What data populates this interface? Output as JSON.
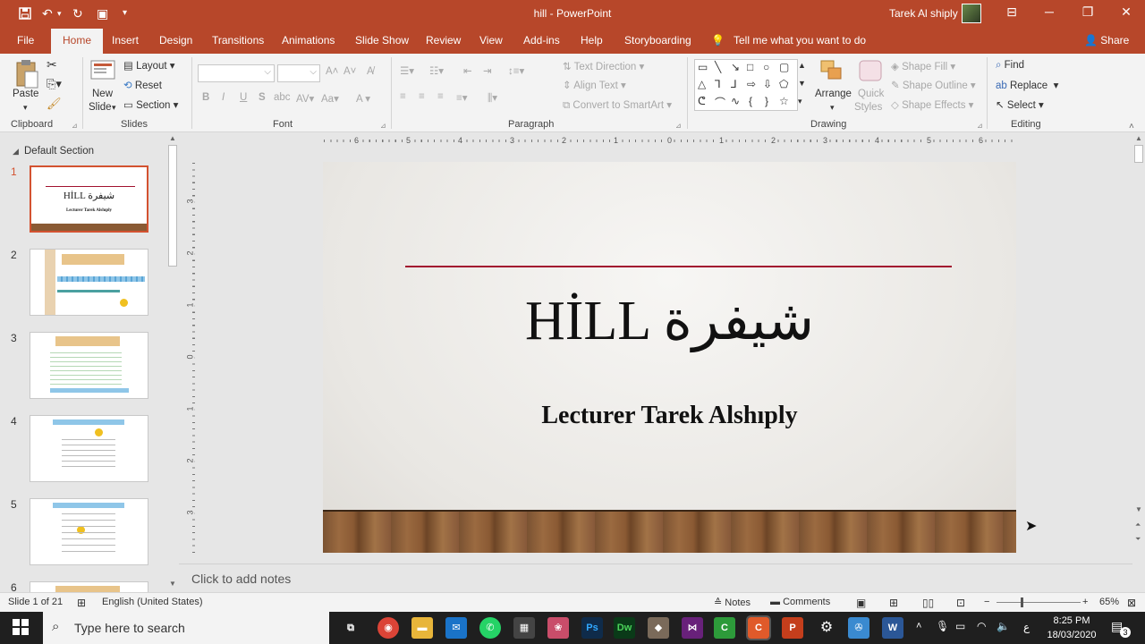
{
  "titlebar": {
    "doc_title": "hill  -  PowerPoint",
    "user": "Tarek Al shiply"
  },
  "tabs": [
    {
      "label": "File",
      "name": "tab-file"
    },
    {
      "label": "Home",
      "name": "tab-home",
      "active": true
    },
    {
      "label": "Insert",
      "name": "tab-insert"
    },
    {
      "label": "Design",
      "name": "tab-design"
    },
    {
      "label": "Transitions",
      "name": "tab-transitions"
    },
    {
      "label": "Animations",
      "name": "tab-animations"
    },
    {
      "label": "Slide Show",
      "name": "tab-slide-show"
    },
    {
      "label": "Review",
      "name": "tab-review"
    },
    {
      "label": "View",
      "name": "tab-view"
    },
    {
      "label": "Add-ins",
      "name": "tab-add-ins"
    },
    {
      "label": "Help",
      "name": "tab-help"
    },
    {
      "label": "Storyboarding",
      "name": "tab-storyboarding"
    }
  ],
  "tell_me": "Tell me what you want to do",
  "share": "Share",
  "ribbon": {
    "clipboard": {
      "label": "Clipboard",
      "paste": "Paste"
    },
    "slides": {
      "label": "Slides",
      "new_slide_1": "New",
      "new_slide_2": "Slide",
      "layout": "Layout",
      "reset": "Reset",
      "section": "Section"
    },
    "font": {
      "label": "Font"
    },
    "paragraph": {
      "label": "Paragraph",
      "text_direction": "Text Direction",
      "align_text": "Align Text",
      "convert_smartart": "Convert to SmartArt"
    },
    "drawing": {
      "label": "Drawing",
      "arrange": "Arrange",
      "quick_styles_1": "Quick",
      "quick_styles_2": "Styles",
      "shape_fill": "Shape Fill",
      "shape_outline": "Shape Outline",
      "shape_effects": "Shape Effects"
    },
    "editing": {
      "label": "Editing",
      "find": "Find",
      "replace": "Replace",
      "select": "Select"
    }
  },
  "thumbnails": {
    "section": "Default Section",
    "items": [
      {
        "num": "1",
        "title": "HİLL شيفرة",
        "sub": "Lecturer Tarek Alshıply"
      },
      {
        "num": "2"
      },
      {
        "num": "3"
      },
      {
        "num": "4"
      },
      {
        "num": "5"
      },
      {
        "num": "6"
      }
    ]
  },
  "ruler": {
    "h": [
      "6",
      "5",
      "4",
      "3",
      "2",
      "1",
      "0",
      "1",
      "2",
      "3",
      "4",
      "5",
      "6"
    ],
    "v": [
      "3",
      "2",
      "1",
      "0",
      "1",
      "2",
      "3"
    ]
  },
  "slide": {
    "title": "HİLL شيفرة",
    "subtitle": "Lecturer Tarek Alshıply",
    "accent": "#a2122f"
  },
  "notes_placeholder": "Click to add notes",
  "status": {
    "slide_count": "Slide 1 of 21",
    "language": "English (United States)",
    "notes": "Notes",
    "comments": "Comments",
    "zoom": "65%"
  },
  "taskbar": {
    "search_placeholder": "Type here to search",
    "time": "8:25 PM",
    "date": "18/03/2020",
    "lang": "ع",
    "notif_count": "3"
  },
  "colors": {
    "brand": "#b7472a",
    "selected": "#d35230"
  }
}
